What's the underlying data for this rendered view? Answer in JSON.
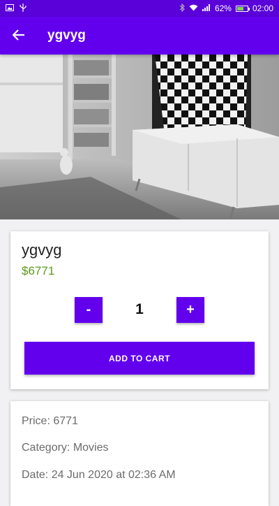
{
  "status_bar": {
    "battery": "62%",
    "time": "02:00",
    "left_icons": [
      "image-icon",
      "usb-icon"
    ],
    "right_icons": [
      "bluetooth-icon",
      "wifi-icon",
      "signal-icon",
      "battery-icon"
    ],
    "battery_level": 0.62,
    "battery_color": "#7cd64a"
  },
  "app_bar": {
    "title": "ygvyg",
    "back_icon": "arrow-back-icon",
    "color": "#6200ee"
  },
  "product": {
    "name": "ygvyg",
    "price": "$6771",
    "quantity": "1",
    "minus_label": "-",
    "plus_label": "+",
    "add_to_cart_label": "ADD TO CART",
    "price_color": "#5c9a1b"
  },
  "details": {
    "price": "Price: 6771",
    "category": "Category: Movies",
    "date": "Date: 24 Jun 2020 at 02:36 AM"
  }
}
